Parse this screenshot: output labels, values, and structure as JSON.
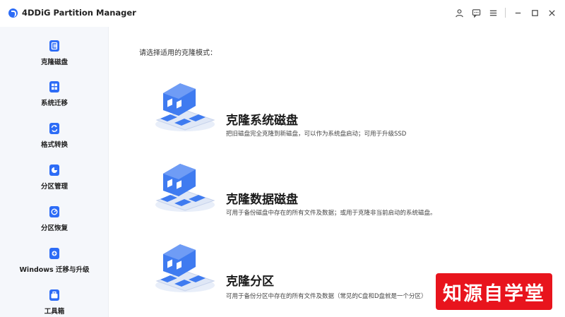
{
  "app": {
    "title": "4DDiG Partition Manager",
    "accent": "#2d6cf6"
  },
  "sidebar": {
    "items": [
      {
        "label": "克隆磁盘",
        "icon": "clone-disk-icon"
      },
      {
        "label": "系统迁移",
        "icon": "system-migrate-icon"
      },
      {
        "label": "格式转换",
        "icon": "format-convert-icon"
      },
      {
        "label": "分区管理",
        "icon": "partition-manage-icon"
      },
      {
        "label": "分区恢复",
        "icon": "partition-recover-icon"
      },
      {
        "label": "Windows 迁移与升级",
        "icon": "windows-upgrade-icon"
      },
      {
        "label": "工具箱",
        "icon": "toolbox-icon"
      }
    ]
  },
  "main": {
    "prompt": "请选择适用的克隆模式：",
    "options": [
      {
        "title": "克隆系统磁盘",
        "desc": "把旧磁盘完全克隆到新磁盘，可以作为系统盘启动；可用于升级SSD"
      },
      {
        "title": "克隆数据磁盘",
        "desc": "可用于备份磁盘中存在的所有文件及数据；或用于克隆非当前启动的系统磁盘。"
      },
      {
        "title": "克隆分区",
        "desc": "可用于备份分区中存在的所有文件及数据（常见的C盘和D盘就是一个分区）"
      }
    ]
  },
  "watermark": {
    "text": "知源自学堂",
    "color": "#e8141d"
  }
}
